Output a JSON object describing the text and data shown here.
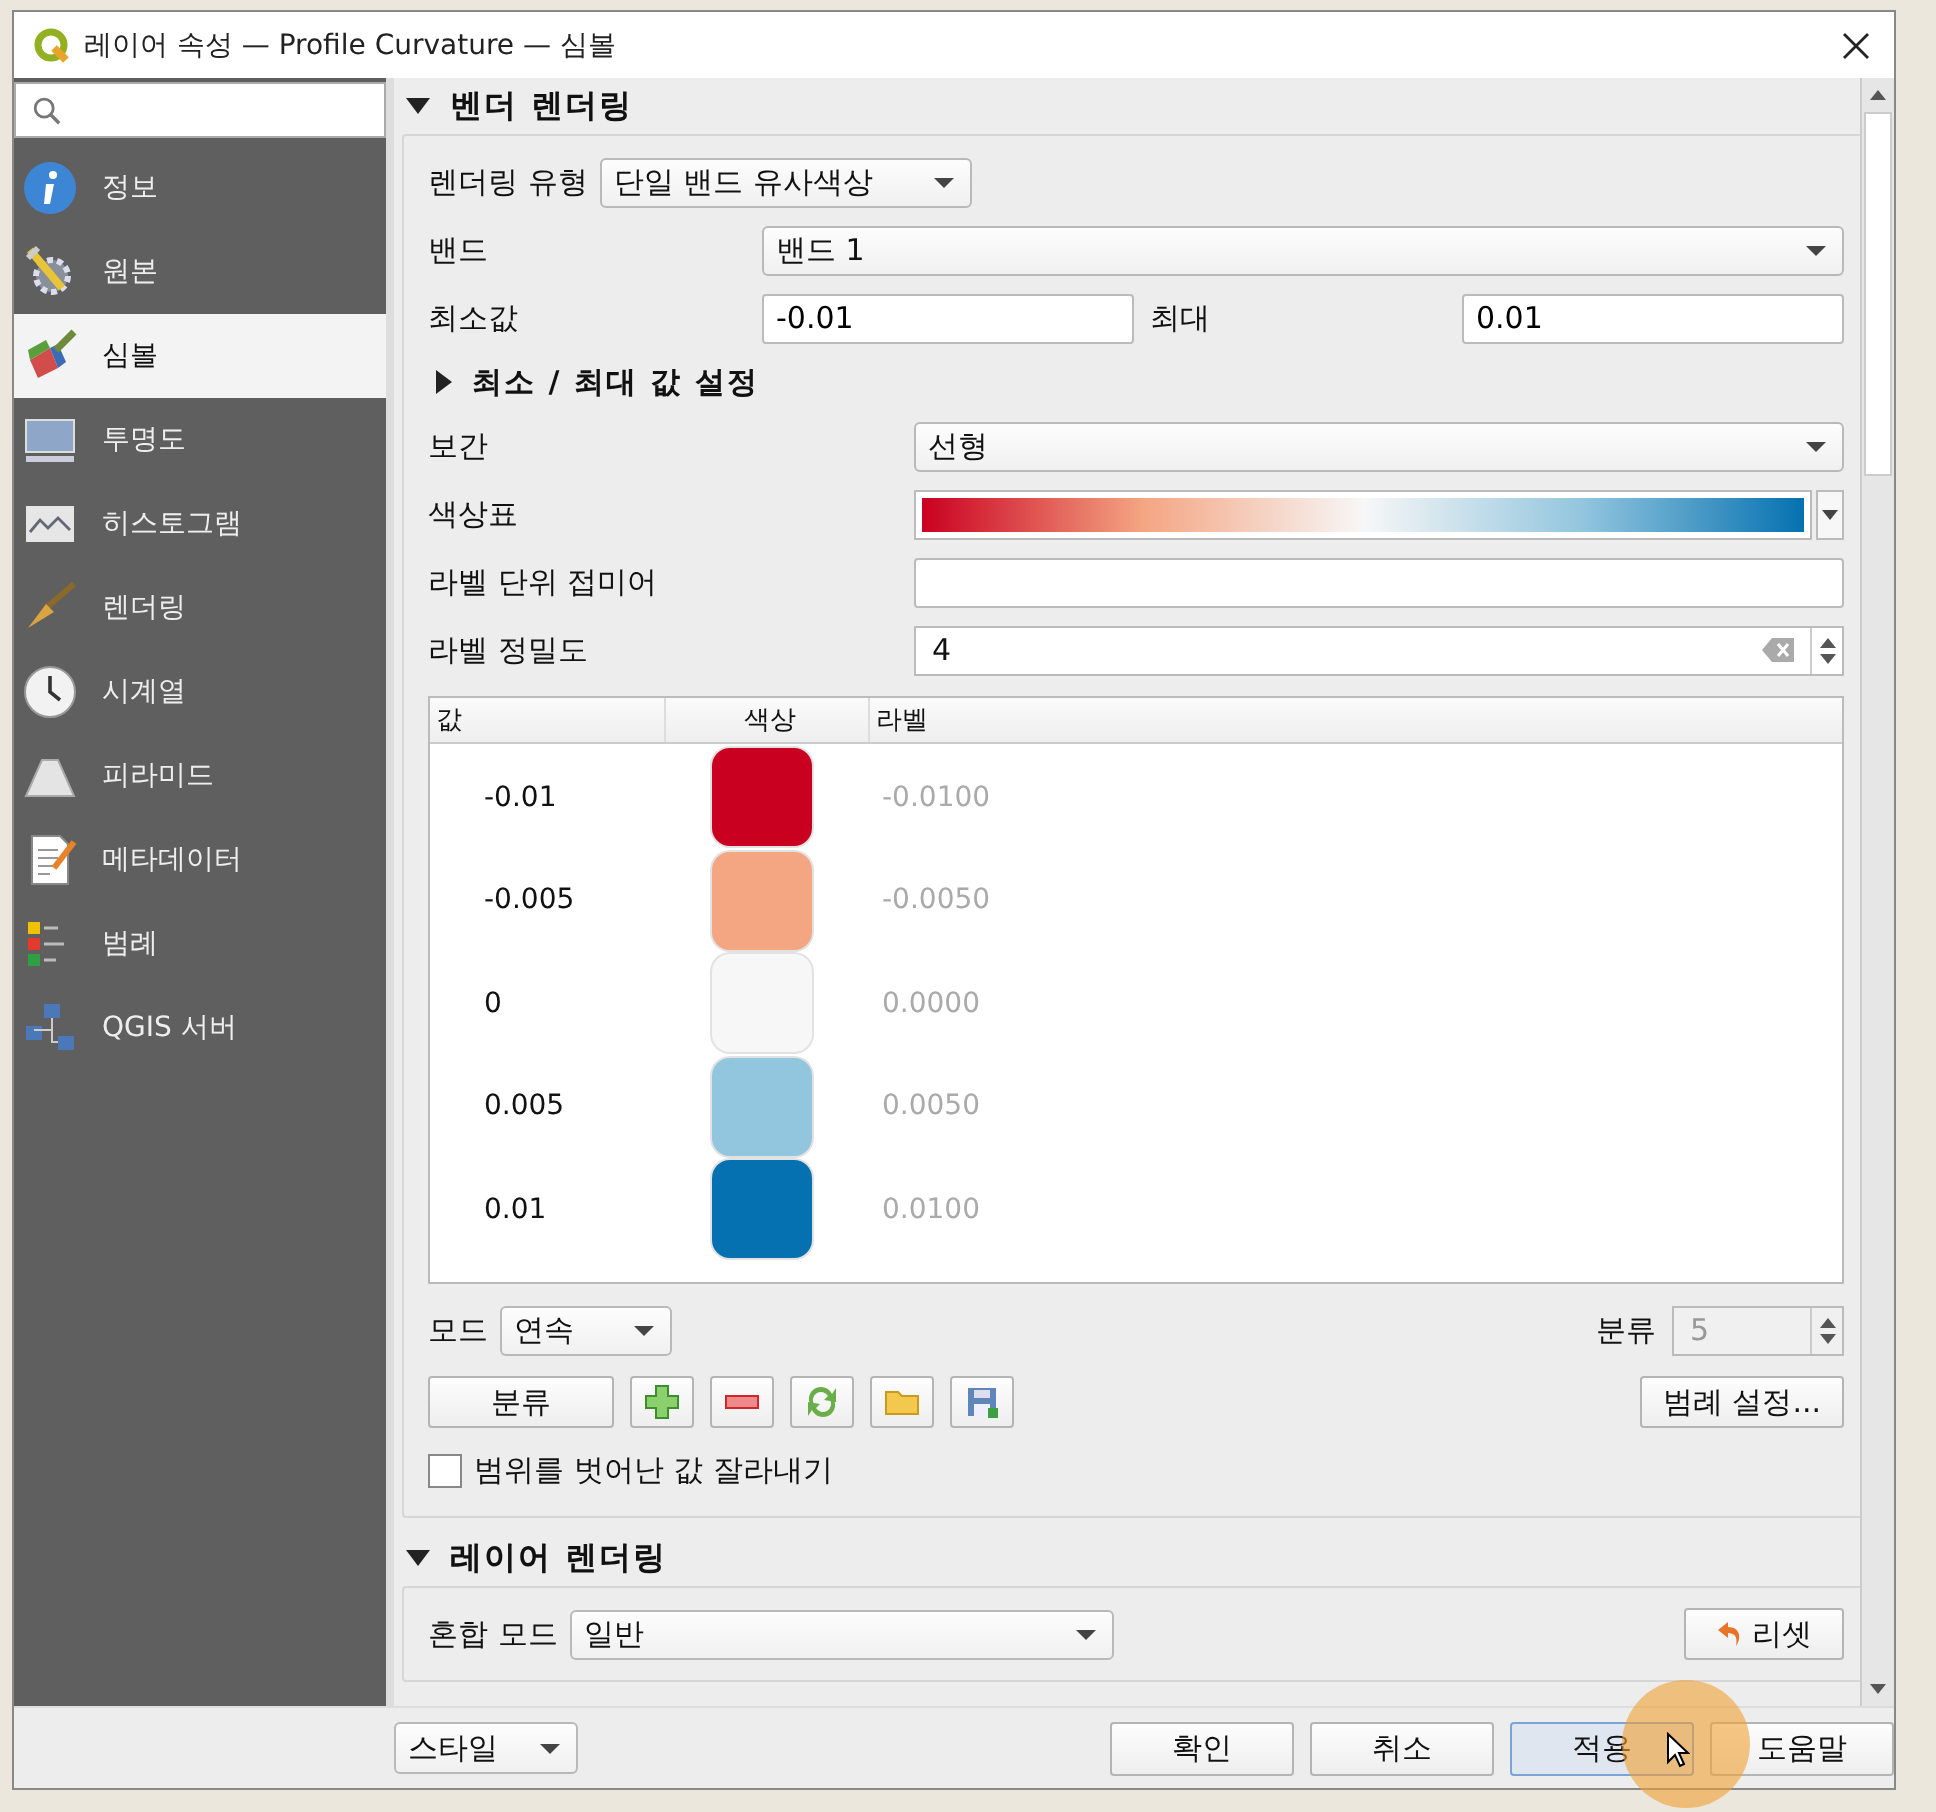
{
  "window": {
    "title": "레이어 속성 — Profile Curvature — 심볼"
  },
  "sidebar": {
    "items": [
      {
        "label": "정보",
        "selected": false
      },
      {
        "label": "원본",
        "selected": false
      },
      {
        "label": "심볼",
        "selected": true
      },
      {
        "label": "투명도",
        "selected": false
      },
      {
        "label": "히스토그램",
        "selected": false
      },
      {
        "label": "렌더링",
        "selected": false
      },
      {
        "label": "시계열",
        "selected": false
      },
      {
        "label": "피라미드",
        "selected": false
      },
      {
        "label": "메타데이터",
        "selected": false
      },
      {
        "label": "범례",
        "selected": false
      },
      {
        "label": "QGIS 서버",
        "selected": false
      }
    ]
  },
  "band_rendering": {
    "title": "벤더 렌더링",
    "expanded": true,
    "render_type": {
      "label": "렌더링 유형",
      "value": "단일 밴드 유사색상"
    },
    "band": {
      "label": "밴드",
      "value": "밴드 1"
    },
    "min": {
      "label": "최소값",
      "value": "-0.01"
    },
    "max": {
      "label": "최대",
      "value": "0.01"
    },
    "minmax_settings": {
      "label": "최소 / 최대 값 설정",
      "expanded": false
    },
    "interpolation": {
      "label": "보간",
      "value": "선형"
    },
    "color_ramp": {
      "label": "색상표"
    },
    "label_suffix": {
      "label": "라벨 단위 접미어"
    },
    "label_precision": {
      "label": "라벨 정밀도",
      "value": "4"
    },
    "table": {
      "columns": [
        "값",
        "색상",
        "라벨"
      ],
      "rows": [
        {
          "value": "-0.01",
          "color": "#ca0020",
          "label": "-0.0100"
        },
        {
          "value": "-0.005",
          "color": "#f4a582",
          "label": "-0.0050"
        },
        {
          "value": "0",
          "color": "#f7f7f7",
          "label": "0.0000"
        },
        {
          "value": "0.005",
          "color": "#92c5de",
          "label": "0.0050"
        },
        {
          "value": "0.01",
          "color": "#0571b0",
          "label": "0.0100"
        }
      ]
    },
    "mode": {
      "label": "모드",
      "value": "연속"
    },
    "classes": {
      "label": "분류",
      "value": "5",
      "disabled": true
    },
    "classify_button": "분류",
    "legend_settings_button": "범례 설정...",
    "clip": {
      "label": "범위를 벗어난 값 잘라내기",
      "checked": false
    }
  },
  "layer_rendering": {
    "title": "레이어 렌더링",
    "expanded": true,
    "blend_mode": {
      "label": "혼합 모드",
      "value": "일반"
    },
    "reset_button": "리셋"
  },
  "footer": {
    "style_button": "스타일",
    "buttons": [
      {
        "label": "확인",
        "hovered": false
      },
      {
        "label": "취소",
        "hovered": false
      },
      {
        "label": "적용",
        "hovered": true
      },
      {
        "label": "도움말",
        "hovered": false
      }
    ]
  }
}
